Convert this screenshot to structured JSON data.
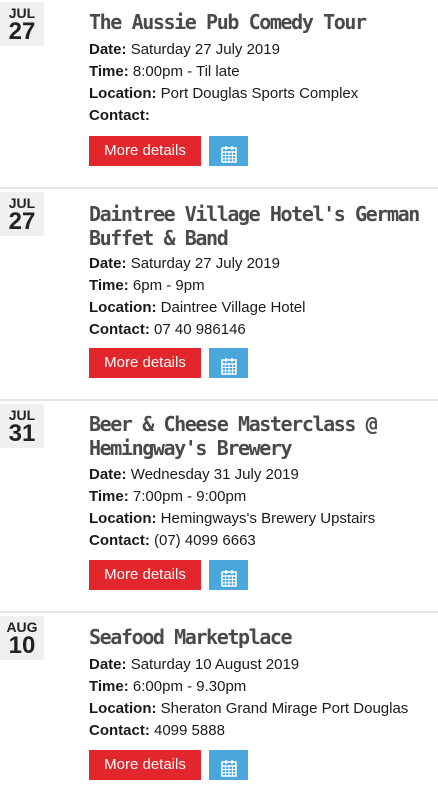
{
  "labels": {
    "date": "Date:",
    "time": "Time:",
    "location": "Location:",
    "contact": "Contact:",
    "more_details": "More details"
  },
  "events": [
    {
      "month": "JUL",
      "day": "27",
      "title": "The Aussie Pub Comedy Tour",
      "date": "Saturday 27 July 2019",
      "time": "8:00pm - Til late",
      "location": "Port Douglas Sports Complex",
      "contact": ""
    },
    {
      "month": "JUL",
      "day": "27",
      "title": "Daintree Village Hotel's German Buffet & Band",
      "date": "Saturday 27 July 2019",
      "time": "6pm - 9pm",
      "location": "Daintree Village Hotel",
      "contact": "07 40 986146"
    },
    {
      "month": "JUL",
      "day": "31",
      "title": "Beer & Cheese Masterclass @ Hemingway's Brewery",
      "date": "Wednesday 31 July 2019",
      "time": "7:00pm - 9:00pm",
      "location": "Hemingways's Brewery Upstairs",
      "contact": "(07) 4099 6663"
    },
    {
      "month": "AUG",
      "day": "10",
      "title": "Seafood Marketplace",
      "date": "Saturday 10 August 2019",
      "time": "6:00pm - 9.30pm",
      "location": "Sheraton Grand Mirage Port Douglas",
      "contact": "4099 5888"
    }
  ],
  "icons": {
    "calendar_button": "calendar-icon"
  },
  "colors": {
    "more_button": "#e3262c",
    "calendar_button": "#4aa7db",
    "title": "#4a4a4a"
  }
}
